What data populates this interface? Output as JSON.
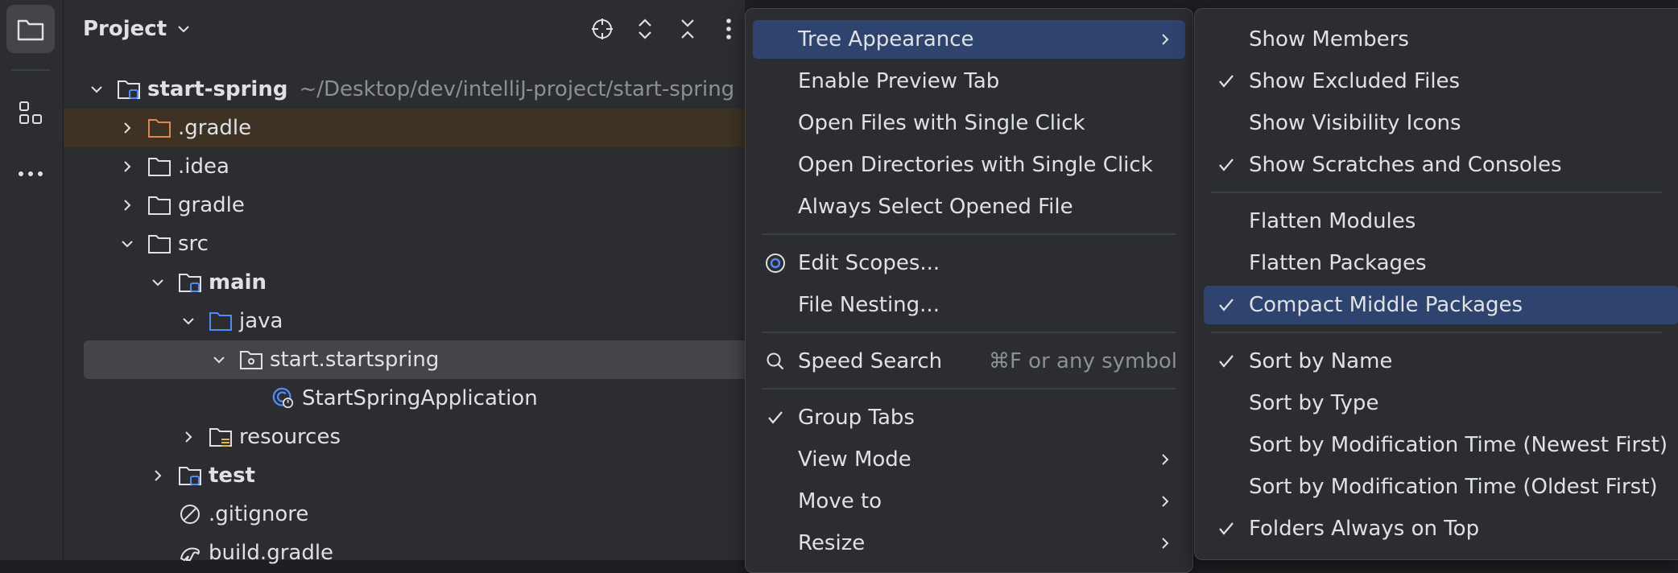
{
  "project_panel": {
    "title": "Project"
  },
  "tree": [
    {
      "label": "start-spring",
      "hint": "~/Desktop/dev/intelliJ-project/start-spring"
    },
    {
      "label": ".gradle"
    },
    {
      "label": ".idea"
    },
    {
      "label": "gradle"
    },
    {
      "label": "src"
    },
    {
      "label": "main"
    },
    {
      "label": "java"
    },
    {
      "label": "start.startspring"
    },
    {
      "label": "StartSpringApplication"
    },
    {
      "label": "resources"
    },
    {
      "label": "test"
    },
    {
      "label": ".gitignore"
    },
    {
      "label": "build.gradle"
    }
  ],
  "menu_main": {
    "items": [
      {
        "label": "Tree Appearance"
      },
      {
        "label": "Enable Preview Tab"
      },
      {
        "label": "Open Files with Single Click"
      },
      {
        "label": "Open Directories with Single Click"
      },
      {
        "label": "Always Select Opened File"
      },
      {
        "label": "Edit Scopes..."
      },
      {
        "label": "File Nesting..."
      },
      {
        "label": "Speed Search",
        "shortcut": "⌘F or any symbol"
      },
      {
        "label": "Group Tabs"
      },
      {
        "label": "View Mode"
      },
      {
        "label": "Move to"
      },
      {
        "label": "Resize"
      }
    ]
  },
  "menu_tree_appearance": {
    "items": [
      {
        "label": "Show Members",
        "checked": false
      },
      {
        "label": "Show Excluded Files",
        "checked": true
      },
      {
        "label": "Show Visibility Icons",
        "checked": false
      },
      {
        "label": "Show Scratches and Consoles",
        "checked": true
      },
      {
        "label": "Flatten Modules",
        "checked": false
      },
      {
        "label": "Flatten Packages",
        "checked": false
      },
      {
        "label": "Compact Middle Packages",
        "checked": true
      },
      {
        "label": "Sort by Name",
        "checked": true
      },
      {
        "label": "Sort by Type",
        "checked": false
      },
      {
        "label": "Sort by Modification Time (Newest First)",
        "checked": false
      },
      {
        "label": "Sort by Modification Time (Oldest First)",
        "checked": false
      },
      {
        "label": "Folders Always on Top",
        "checked": true
      }
    ]
  },
  "colors": {
    "highlight": "#2e436e",
    "excluded_row": "#3d3224",
    "selected_row": "#43454a",
    "folder_blue": "#548af7",
    "folder_orange": "#e08855"
  }
}
